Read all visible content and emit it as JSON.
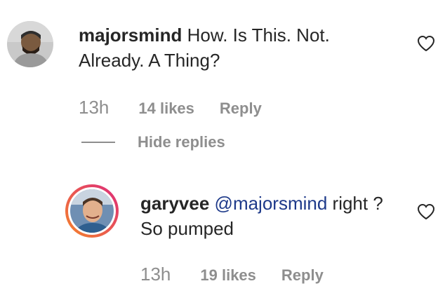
{
  "comments": [
    {
      "username": "majorsmind",
      "text": "How. Is This. Not. Already. A Thing?",
      "time": "13h",
      "likes": "14 likes",
      "reply_label": "Reply"
    }
  ],
  "hide_replies_label": "Hide replies",
  "replies": [
    {
      "username": "garyvee",
      "mention": "@majorsmind",
      "text": " right ? So pumped",
      "time": "13h",
      "likes": "19 likes",
      "reply_label": "Reply"
    }
  ],
  "icons": {
    "like": "heart-outline-icon"
  },
  "colors": {
    "mention": "#1e3a8a",
    "meta": "#8e8e8e",
    "story_ring_start": "#f58529",
    "story_ring_end": "#dd2a7b"
  }
}
